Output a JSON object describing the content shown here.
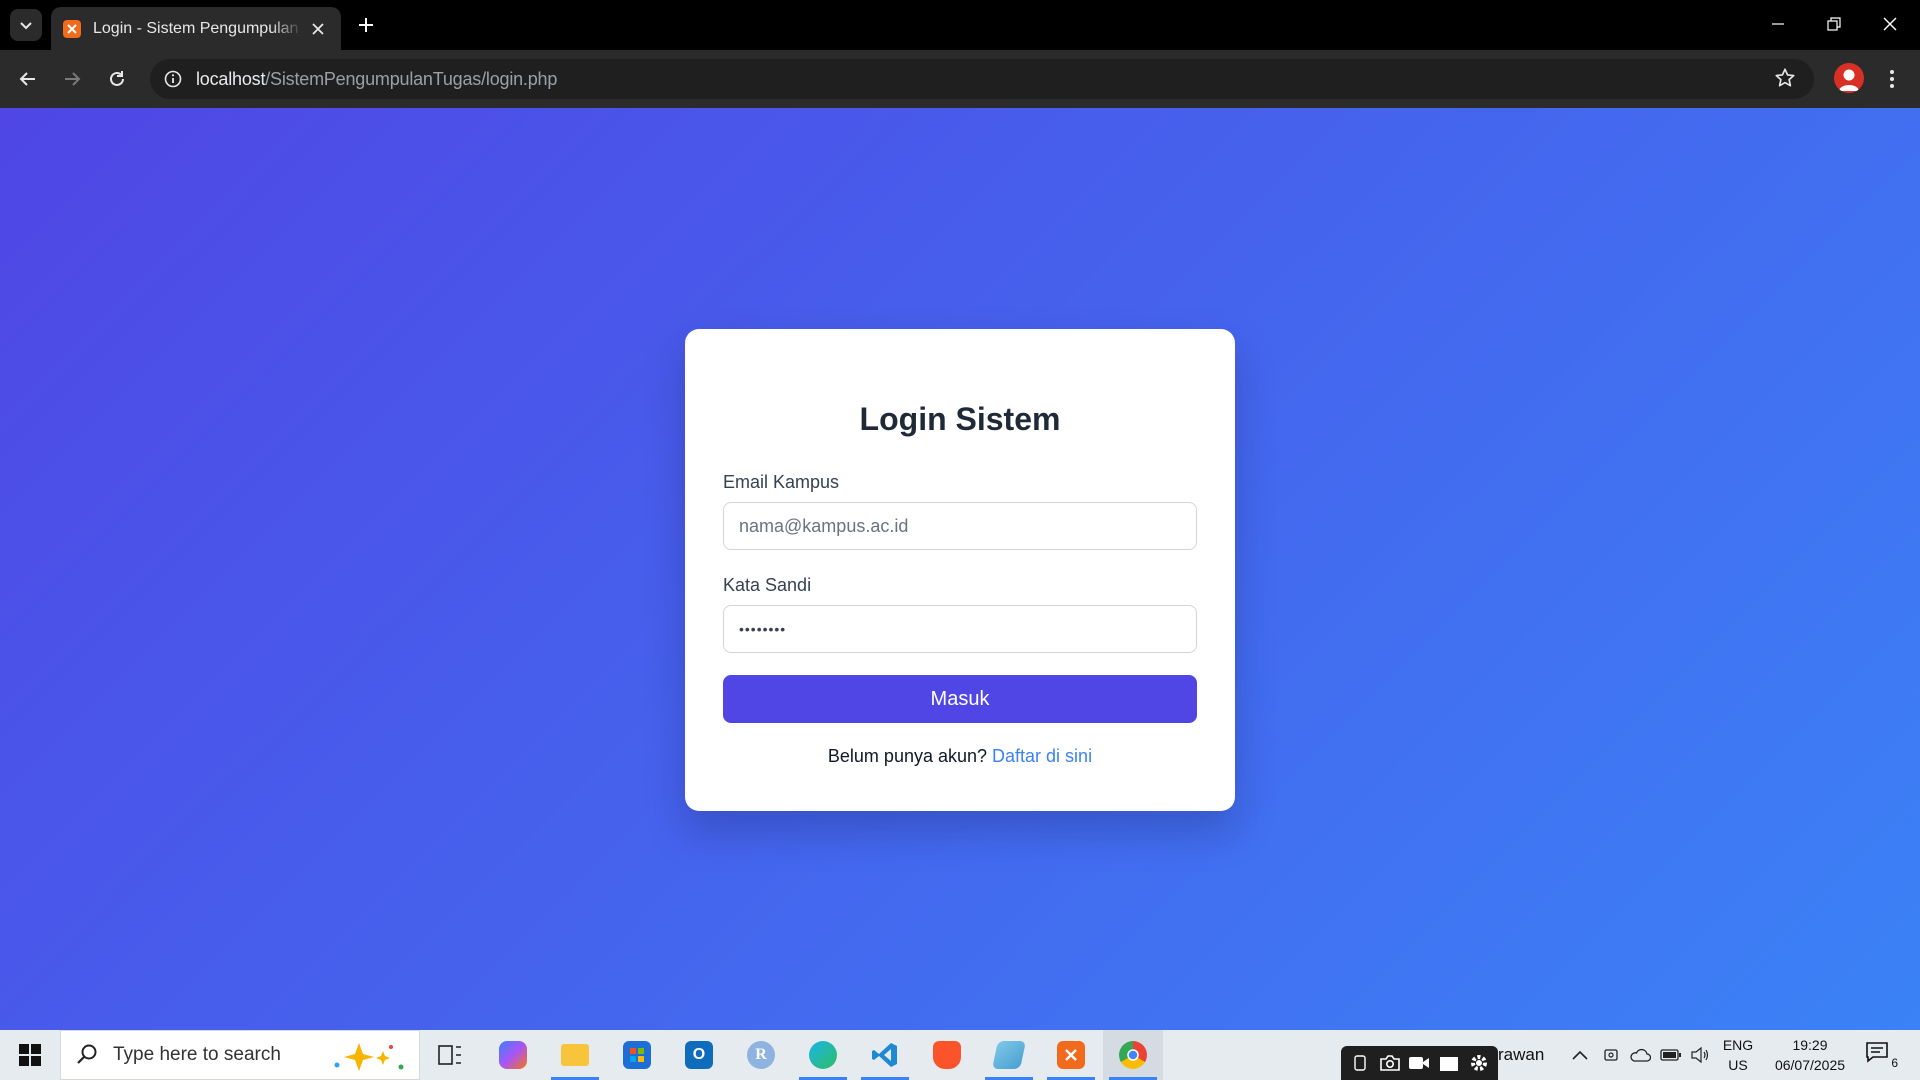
{
  "browser": {
    "tab_title": "Login - Sistem Pengumpulan Tugas",
    "url_host": "localhost",
    "url_path": "/SistemPengumpulanTugas/login.php"
  },
  "login": {
    "title": "Login Sistem",
    "email_label": "Email Kampus",
    "email_placeholder": "nama@kampus.ac.id",
    "password_label": "Kata Sandi",
    "password_value": "••••••••",
    "submit_label": "Masuk",
    "register_prompt": "Belum punya akun?",
    "register_link": "Daftar di sini"
  },
  "colors": {
    "gradient_start": "#4f46e5",
    "gradient_end": "#3b82f6",
    "primary_button": "#4f46e5",
    "link": "#3b82f6"
  },
  "taskbar": {
    "search_placeholder": "Type here to search",
    "apps": [
      "task-view-icon",
      "copilot-icon",
      "file-explorer-icon",
      "microsoft-store-icon",
      "outlook-icon",
      "r-app-icon",
      "edge-icon",
      "vscode-icon",
      "brave-icon",
      "notes-icon",
      "xampp-icon",
      "chrome-icon"
    ],
    "user_name_fragment": "rawan",
    "language": "ENG",
    "region": "US",
    "time": "19:29",
    "date": "06/07/2025",
    "notification_count": "6"
  }
}
